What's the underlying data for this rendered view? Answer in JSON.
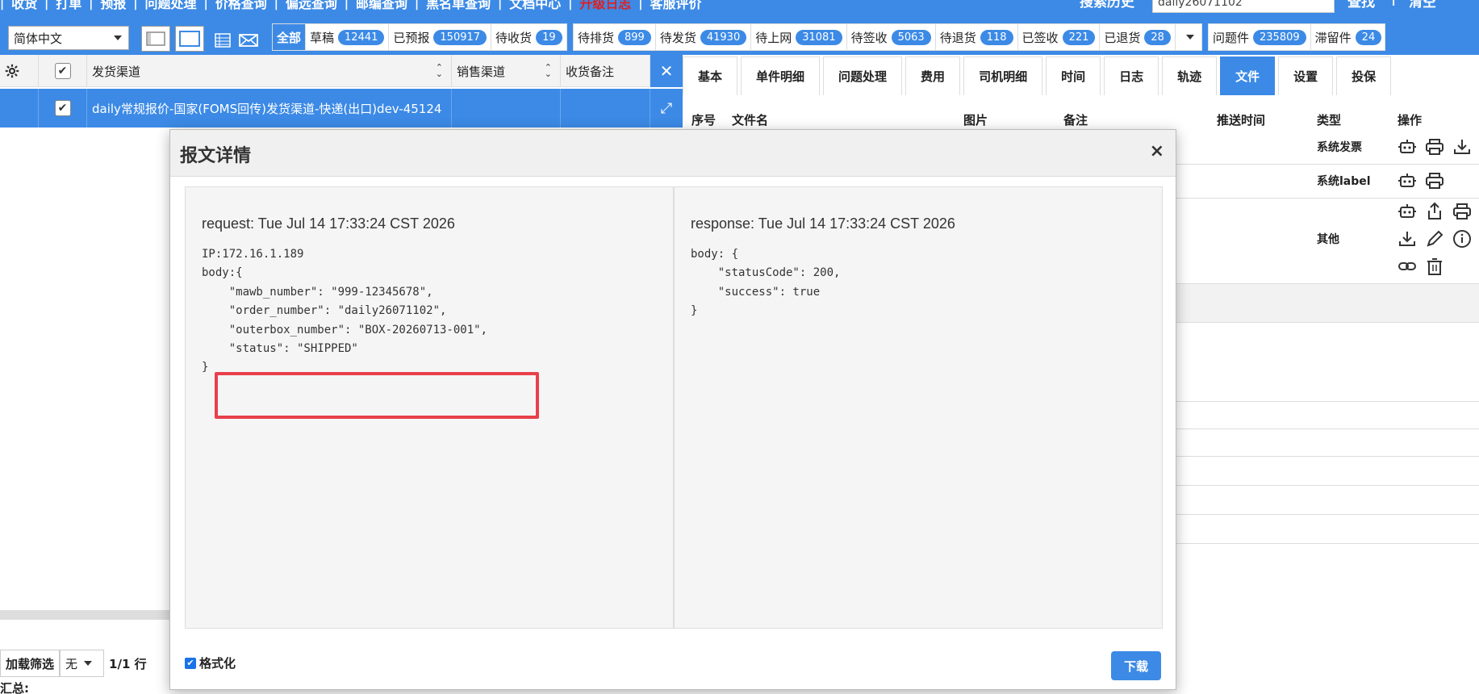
{
  "nav": {
    "items": [
      "收货",
      "打单",
      "预报",
      "问题处理",
      "价格查询",
      "偏远查询",
      "邮编查询",
      "黑名单查询",
      "文档中心",
      "升级日志",
      "客服评价"
    ],
    "highlight_color": "#e02020",
    "search_history_label": "搜索历史",
    "search_value": "daily26071102",
    "search_button": "查找",
    "clear_button": "清空"
  },
  "toolbar": {
    "language": "简体中文",
    "stats": [
      {
        "label": "全部",
        "count": null
      },
      {
        "label": "草稿",
        "count": "12441"
      },
      {
        "label": "已预报",
        "count": "150917"
      },
      {
        "label": "待收货",
        "count": "19"
      }
    ],
    "stats2": [
      {
        "label": "待排货",
        "count": "899"
      },
      {
        "label": "待发货",
        "count": "41930"
      },
      {
        "label": "待上网",
        "count": "31081"
      },
      {
        "label": "待签收",
        "count": "5063"
      },
      {
        "label": "待退货",
        "count": "118"
      },
      {
        "label": "已签收",
        "count": "221"
      },
      {
        "label": "已退货",
        "count": "28"
      }
    ],
    "stats3": [
      {
        "label": "问题件",
        "count": "235809"
      },
      {
        "label": "滞留件",
        "count": "24"
      }
    ]
  },
  "grid": {
    "columns": [
      "发货渠道",
      "销售渠道",
      "收货备注"
    ],
    "row_channel": "daily常规报价-国家(FOMS回传)发货渠道-快递(出口)dev-45124"
  },
  "bottom": {
    "load_filter": "加载筛选",
    "none": "无",
    "rows": "1/1 行",
    "summary": "汇总:"
  },
  "right": {
    "tabs": [
      "基本",
      "单件明细",
      "问题处理",
      "费用",
      "司机明细",
      "时间",
      "日志",
      "轨迹",
      "文件",
      "设置",
      "投保"
    ],
    "active_tab": "文件",
    "headers": [
      "序号",
      "文件名",
      "图片",
      "备注",
      "推送时间",
      "类型",
      "操作"
    ],
    "rows": [
      {
        "type": "系统发票"
      },
      {
        "type": "系统label"
      },
      {
        "type": "其他"
      }
    ]
  },
  "modal": {
    "title": "报文详情",
    "close": "×",
    "request_title": "request: Tue Jul 14 17:33:24 CST 2026",
    "request_body": "IP:172.16.1.189\nbody:{\n    \"mawb_number\": \"999-12345678\",\n    \"order_number\": \"daily26071102\",\n    \"outerbox_number\": \"BOX-20260713-001\",\n    \"status\": \"SHIPPED\"\n}",
    "response_title": "response: Tue Jul 14 17:33:24 CST 2026",
    "response_body": "body: {\n    \"statusCode\": 200,\n    \"success\": true\n}",
    "format_label": "格式化",
    "download": "下载"
  }
}
